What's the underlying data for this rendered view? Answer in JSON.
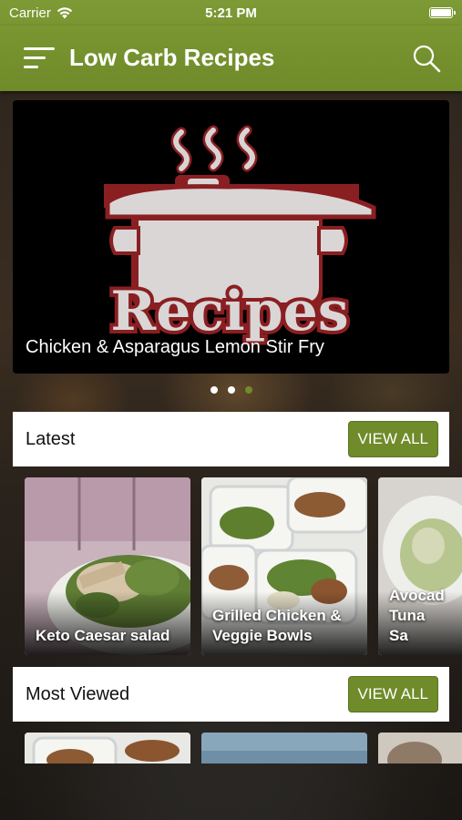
{
  "status_bar": {
    "carrier": "Carrier",
    "time": "5:21 PM"
  },
  "header": {
    "title": "Low Carb Recipes",
    "menu_icon": "hamburger-menu-icon",
    "search_icon": "search-icon",
    "accent_color": "#6f8b2a"
  },
  "hero": {
    "logo_text": "Recipes",
    "caption": "Chicken & Asparagus Lemon Stir Fry",
    "pager_total": 3,
    "pager_active": 3
  },
  "latest": {
    "title": "Latest",
    "view_all_label": "VIEW ALL",
    "items": [
      {
        "label": "Keto Caesar salad"
      },
      {
        "label": "Grilled Chicken & Veggie Bowls"
      },
      {
        "label": "Avocado Tuna Salad",
        "visible_label": "Avocad Tuna Sa"
      }
    ]
  },
  "most_viewed": {
    "title": "Most Viewed",
    "view_all_label": "VIEW ALL"
  }
}
